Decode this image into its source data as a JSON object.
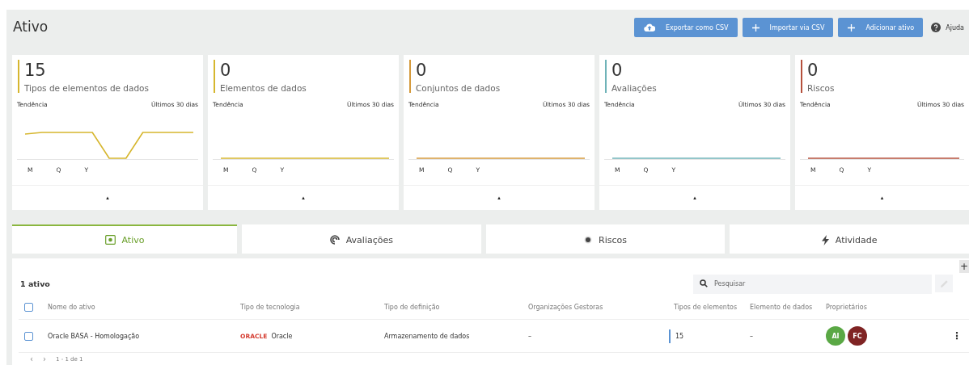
{
  "header": {
    "title": "Ativo",
    "buttons": [
      {
        "kind": "export",
        "label": "Exportar como CSV"
      },
      {
        "kind": "add",
        "label": "Importar via CSV"
      },
      {
        "kind": "add",
        "label": "Adicionar ativo"
      }
    ],
    "help": "Ajuda"
  },
  "cards": [
    {
      "value": "15",
      "label": "Tipos de elementos de dados",
      "color": "#d6b62e",
      "trend_label": "Tendência",
      "period": "Últimos 30 dias",
      "trend": {
        "kind": "dip"
      },
      "ranges": [
        "M",
        "Q",
        "Y"
      ],
      "toggle": "▴"
    },
    {
      "value": "0",
      "label": "Elementos de dados",
      "color": "#d6b62e",
      "trend_label": "Tendência",
      "period": "Últimos 30 dias",
      "trend": {
        "kind": "flat"
      },
      "ranges": [
        "M",
        "Q",
        "Y"
      ],
      "toggle": "▴"
    },
    {
      "value": "0",
      "label": "Conjuntos de dados",
      "color": "#d49a3c",
      "trend_label": "Tendência",
      "period": "Últimos 30 dias",
      "trend": {
        "kind": "flat"
      },
      "ranges": [
        "M",
        "Q",
        "Y"
      ],
      "toggle": "▴"
    },
    {
      "value": "0",
      "label": "Avaliações",
      "color": "#6fb3b8",
      "trend_label": "Tendência",
      "period": "Últimos 30 dias",
      "trend": {
        "kind": "flat"
      },
      "ranges": [
        "M",
        "Q",
        "Y"
      ],
      "toggle": "▴"
    },
    {
      "value": "0",
      "label": "Riscos",
      "color": "#b5503c",
      "trend_label": "Tendência",
      "period": "Últimos 30 dias",
      "trend": {
        "kind": "flat"
      },
      "ranges": [
        "M",
        "Q",
        "Y"
      ],
      "toggle": "▴"
    }
  ],
  "tabs": [
    {
      "kind": "asset",
      "label": "Ativo",
      "selected": true
    },
    {
      "kind": "assessment",
      "label": "Avaliações",
      "selected": false
    },
    {
      "kind": "risk",
      "label": "Riscos",
      "selected": false
    },
    {
      "kind": "activity",
      "label": "Atividade",
      "selected": false
    }
  ],
  "table": {
    "count": "1 ativo",
    "search": {
      "placeholder": "Pesquisar"
    },
    "add": "+",
    "select_all": {
      "checked": false
    },
    "columns": [
      "Nome do ativo",
      "Tipo de tecnologia",
      "Tipo de definição",
      "Organizações Gestoras",
      "Tipos de elementos",
      "Elemento de dados",
      "Proprietários"
    ],
    "rows": [
      {
        "checked": false,
        "name": "Oracle BASA - Homologação",
        "logo": "ORACLE",
        "technology": "Oracle",
        "definition": "Armazenamento de dados",
        "organizations": "–",
        "element_types": "15",
        "data_elements": "–",
        "owners": [
          {
            "initials": "AI",
            "color": "#5aa845"
          },
          {
            "initials": "FC",
            "color": "#7f2424"
          }
        ],
        "menu": "⋮"
      }
    ],
    "pagination": {
      "prev": "‹",
      "next": "›",
      "range": "1 - 1 de 1"
    }
  }
}
